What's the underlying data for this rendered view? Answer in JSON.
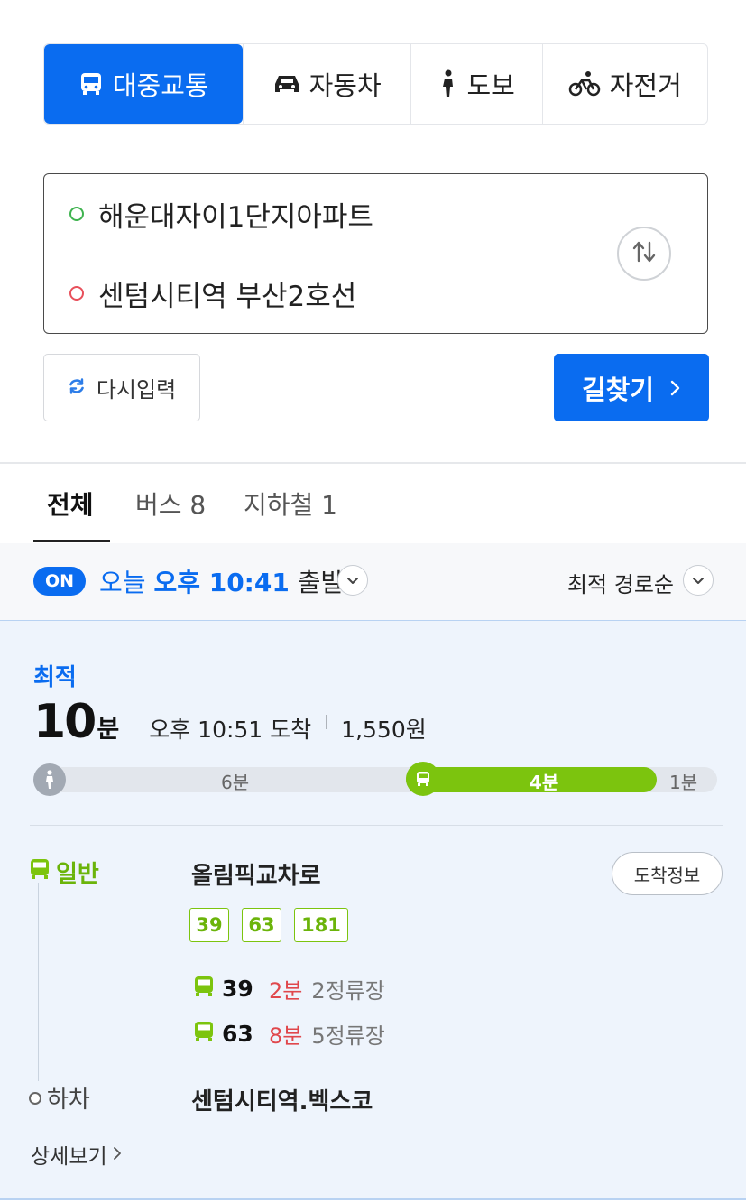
{
  "mode_tabs": [
    {
      "label": "대중교통",
      "icon": "bus-icon",
      "active": true
    },
    {
      "label": "자동차",
      "icon": "car-icon",
      "active": false
    },
    {
      "label": "도보",
      "icon": "walk-icon",
      "active": false
    },
    {
      "label": "자전거",
      "icon": "bicycle-icon",
      "active": false
    }
  ],
  "route": {
    "origin": "해운대자이1단지아파트",
    "destination": "센텀시티역 부산2호선"
  },
  "actions": {
    "reset_label": "다시입력",
    "search_label": "길찾기"
  },
  "result_tabs": [
    {
      "label": "전체",
      "active": true
    },
    {
      "label": "버스 8",
      "active": false
    },
    {
      "label": "지하철 1",
      "active": false
    }
  ],
  "filter": {
    "on_badge": "ON",
    "depart_prefix": "오늘",
    "depart_time": "오후 10:41",
    "depart_suffix": "출발",
    "sort_label": "최적 경로순"
  },
  "result": {
    "badge": "최적",
    "duration_value": "10",
    "duration_unit": "분",
    "arrival": "오후 10:51 도착",
    "fare": "1,550원",
    "timeline": {
      "walk1": "6분",
      "bus": "4분",
      "walk2": "1분"
    },
    "bus_type": "일반",
    "board_stop": "올림픽교차로",
    "arrive_info_label": "도착정보",
    "routes": [
      "39",
      "63",
      "181"
    ],
    "arrivals": [
      {
        "route": "39",
        "eta": "2분",
        "stops": "2정류장"
      },
      {
        "route": "63",
        "eta": "8분",
        "stops": "5정류장"
      }
    ],
    "alight_label": "하차",
    "alight_stop": "센텀시티역.벡스코",
    "detail_label": "상세보기"
  },
  "colors": {
    "primary": "#0a6cf0",
    "bus_green": "#7cc40e",
    "eta_red": "#e0474c",
    "card_bg": "#eef4fc"
  }
}
